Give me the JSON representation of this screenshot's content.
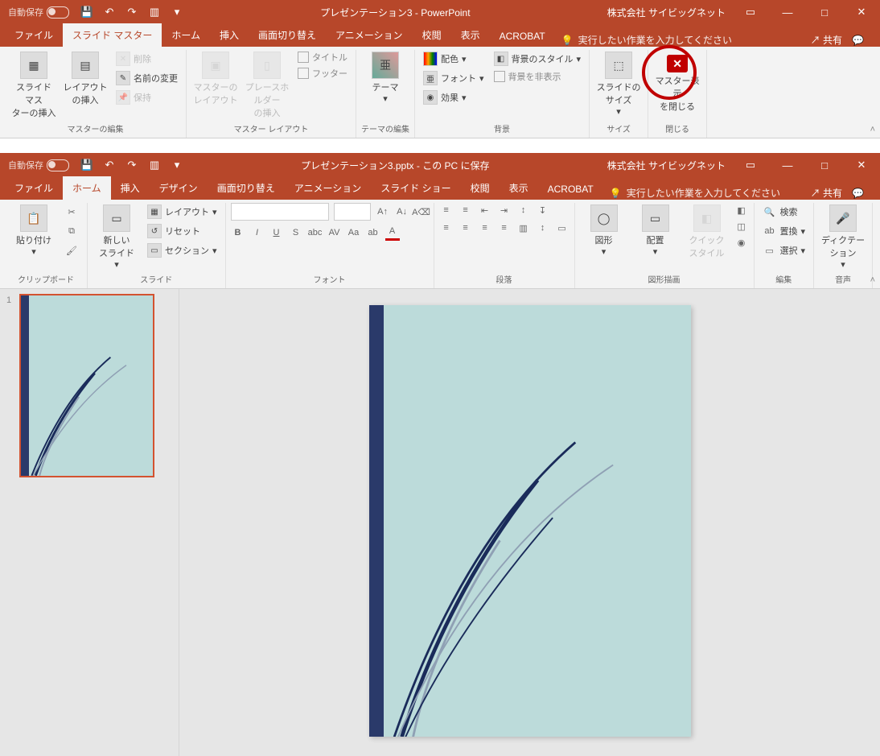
{
  "win1": {
    "autosave": "自動保存",
    "title": "プレゼンテーション3 - PowerPoint",
    "account": "株式会社 サイビッグネット",
    "share": "共有",
    "tabs": [
      "ファイル",
      "スライド マスター",
      "ホーム",
      "挿入",
      "画面切り替え",
      "アニメーション",
      "校閲",
      "表示",
      "ACROBAT"
    ],
    "tell": "実行したい作業を入力してください",
    "groups": {
      "g1": {
        "b1": "スライド マス\nターの挿入",
        "b2": "レイアウト\nの挿入",
        "s1": "削除",
        "s2": "名前の変更",
        "s3": "保持",
        "label": "マスターの編集"
      },
      "g2": {
        "b1": "マスターの\nレイアウト",
        "b2": "プレースホルダー\nの挿入",
        "c1": "タイトル",
        "c2": "フッター",
        "label": "マスター レイアウト"
      },
      "g3": {
        "b1": "テーマ",
        "label": "テーマの編集"
      },
      "g4": {
        "s1": "配色",
        "s2": "フォント",
        "s3": "効果",
        "c1": "背景のスタイル",
        "c2": "背景を非表示",
        "label": "背景"
      },
      "g5": {
        "b1": "スライドの\nサイズ",
        "label": "サイズ"
      },
      "g6": {
        "b1": "マスター表示\nを閉じる",
        "label": "閉じる"
      }
    }
  },
  "win2": {
    "autosave": "自動保存",
    "title": "プレゼンテーション3.pptx - この PC に保存",
    "account": "株式会社 サイビッグネット",
    "share": "共有",
    "tabs": [
      "ファイル",
      "ホーム",
      "挿入",
      "デザイン",
      "画面切り替え",
      "アニメーション",
      "スライド ショー",
      "校閲",
      "表示",
      "ACROBAT"
    ],
    "tell": "実行したい作業を入力してください",
    "groups": {
      "clip": {
        "b1": "貼り付け",
        "label": "クリップボード"
      },
      "slide": {
        "b1": "新しい\nスライド",
        "s1": "レイアウト",
        "s2": "リセット",
        "s3": "セクション",
        "label": "スライド"
      },
      "font": {
        "label": "フォント"
      },
      "para": {
        "label": "段落"
      },
      "draw": {
        "b1": "図形",
        "b2": "配置",
        "b3": "クイック\nスタイル",
        "label": "図形描画"
      },
      "edit": {
        "s1": "検索",
        "s2": "置換",
        "s3": "選択",
        "label": "編集"
      },
      "voice": {
        "b1": "ディクテー\nション",
        "label": "音声"
      }
    },
    "slidenum": "1"
  }
}
